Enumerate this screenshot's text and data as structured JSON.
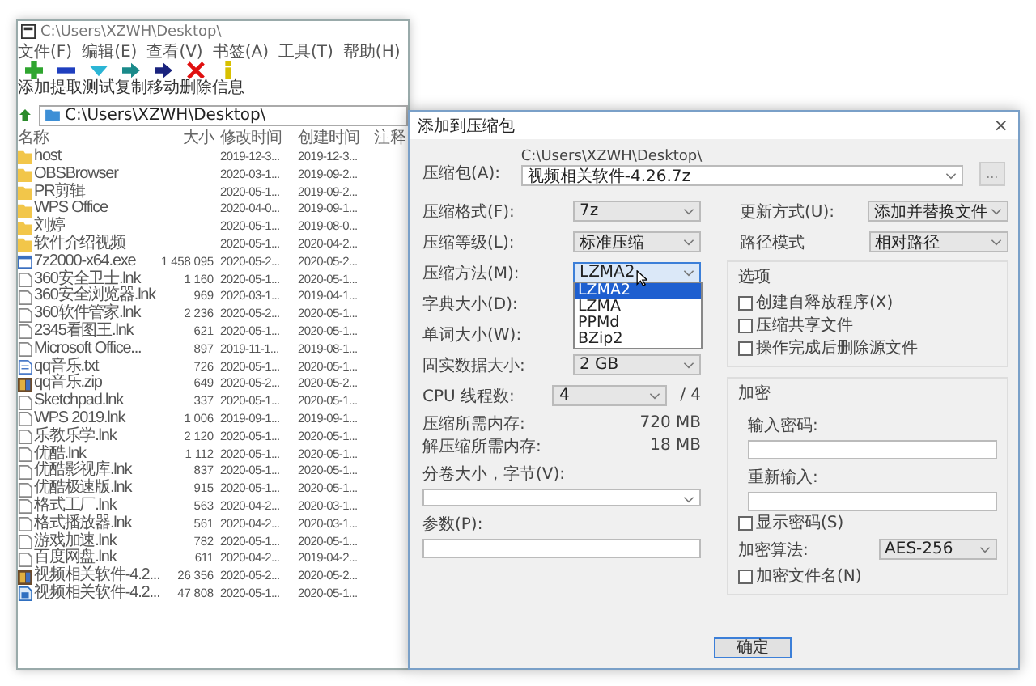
{
  "window": {
    "title": "C:\\Users\\XZWH\\Desktop\\"
  },
  "menu": [
    "文件(F)",
    "编辑(E)",
    "查看(V)",
    "书签(A)",
    "工具(T)",
    "帮助(H)"
  ],
  "toolbar": [
    {
      "label": "添加",
      "kind": "add"
    },
    {
      "label": "提取",
      "kind": "extract"
    },
    {
      "label": "测试",
      "kind": "test"
    },
    {
      "label": "复制",
      "kind": "copy"
    },
    {
      "label": "移动",
      "kind": "move"
    },
    {
      "label": "删除",
      "kind": "delete"
    },
    {
      "label": "信息",
      "kind": "info"
    }
  ],
  "address": "C:\\Users\\XZWH\\Desktop\\",
  "columns": [
    "名称",
    "大小",
    "修改时间",
    "创建时间",
    "注释"
  ],
  "files": [
    {
      "name": "host",
      "kind": "folder",
      "modified": "2019-12-3...",
      "created": "2019-12-3..."
    },
    {
      "name": "OBSBrowser",
      "kind": "folder",
      "modified": "2020-03-1...",
      "created": "2019-09-2..."
    },
    {
      "name": "PR剪辑",
      "kind": "folder",
      "modified": "2020-05-1...",
      "created": "2019-09-2..."
    },
    {
      "name": "WPS Office",
      "kind": "folder",
      "modified": "2020-04-0...",
      "created": "2019-09-1..."
    },
    {
      "name": "刘婷",
      "kind": "folder",
      "modified": "2020-05-1...",
      "created": "2019-08-0..."
    },
    {
      "name": "软件介绍视频",
      "kind": "folder",
      "modified": "2020-05-1...",
      "created": "2020-04-2..."
    },
    {
      "name": "7z2000-x64.exe",
      "kind": "exe",
      "size": "1 458 095",
      "modified": "2020-05-2...",
      "created": "2020-05-2..."
    },
    {
      "name": "360安全卫士.lnk",
      "kind": "file",
      "size": "1 160",
      "modified": "2020-05-1...",
      "created": "2020-05-1..."
    },
    {
      "name": "360安全浏览器.lnk",
      "kind": "file",
      "size": "969",
      "modified": "2020-03-1...",
      "created": "2019-04-1..."
    },
    {
      "name": "360软件管家.lnk",
      "kind": "file",
      "size": "2 236",
      "modified": "2020-05-2...",
      "created": "2020-05-1..."
    },
    {
      "name": "2345看图王.lnk",
      "kind": "file",
      "size": "621",
      "modified": "2020-05-1...",
      "created": "2020-05-1..."
    },
    {
      "name": "Microsoft Office...",
      "kind": "file",
      "size": "897",
      "modified": "2019-11-1...",
      "created": "2019-08-1..."
    },
    {
      "name": "qq音乐.txt",
      "kind": "txt",
      "size": "726",
      "modified": "2020-05-1...",
      "created": "2020-05-1..."
    },
    {
      "name": "qq音乐.zip",
      "kind": "archive",
      "size": "649",
      "modified": "2020-05-2...",
      "created": "2020-05-2..."
    },
    {
      "name": "Sketchpad.lnk",
      "kind": "file",
      "size": "337",
      "modified": "2020-05-1...",
      "created": "2020-05-1..."
    },
    {
      "name": "WPS 2019.lnk",
      "kind": "file",
      "size": "1 006",
      "modified": "2019-09-1...",
      "created": "2019-09-1..."
    },
    {
      "name": "乐教乐学.lnk",
      "kind": "file",
      "size": "2 120",
      "modified": "2020-05-1...",
      "created": "2020-05-1..."
    },
    {
      "name": "优酷.lnk",
      "kind": "file",
      "size": "1 112",
      "modified": "2020-05-1...",
      "created": "2020-05-1..."
    },
    {
      "name": "优酷影视库.lnk",
      "kind": "file",
      "size": "837",
      "modified": "2020-05-1...",
      "created": "2020-05-1..."
    },
    {
      "name": "优酷极速版.lnk",
      "kind": "file",
      "size": "915",
      "modified": "2020-05-1...",
      "created": "2020-05-1..."
    },
    {
      "name": "格式工厂.lnk",
      "kind": "file",
      "size": "563",
      "modified": "2020-04-2...",
      "created": "2020-03-1..."
    },
    {
      "name": "格式播放器.lnk",
      "kind": "file",
      "size": "561",
      "modified": "2020-04-2...",
      "created": "2020-03-1..."
    },
    {
      "name": "游戏加速.lnk",
      "kind": "file",
      "size": "782",
      "modified": "2020-05-1...",
      "created": "2020-05-1..."
    },
    {
      "name": "百度网盘.lnk",
      "kind": "file",
      "size": "611",
      "modified": "2020-04-2...",
      "created": "2019-04-2..."
    },
    {
      "name": "视频相关软件-4.2...",
      "kind": "archive",
      "size": "26 356",
      "modified": "2020-05-2...",
      "created": "2020-05-2..."
    },
    {
      "name": "视频相关软件-4.2...",
      "kind": "app",
      "size": "47 808",
      "modified": "2020-05-1...",
      "created": "2020-05-1..."
    }
  ],
  "dialog": {
    "title": "添加到压缩包",
    "close": "×",
    "archive_label": "压缩包(A):",
    "archive_path": "C:\\Users\\XZWH\\Desktop\\",
    "archive_name": "视频相关软件-4.26.7z",
    "browse": "...",
    "left_rows": [
      {
        "label": "压缩格式(F):",
        "value": "7z"
      },
      {
        "label": "压缩等级(L):",
        "value": "标准压缩"
      },
      {
        "label": "压缩方法(M):",
        "value": "LZMA2",
        "focused": true
      },
      {
        "label": "字典大小(D):"
      },
      {
        "label": "单词大小(W):"
      },
      {
        "label": "固实数据大小:",
        "value": "2 GB"
      },
      {
        "label": "CPU 线程数:",
        "value": "4",
        "suffix": "/ 4"
      }
    ],
    "method_options": [
      {
        "label": "LZMA2",
        "selected": true
      },
      {
        "label": "LZMA",
        "selected": false
      },
      {
        "label": "PPMd",
        "selected": false
      },
      {
        "label": "BZip2",
        "selected": false
      }
    ],
    "memory": [
      {
        "label": "压缩所需内存:",
        "value": "720 MB"
      },
      {
        "label": "解压缩所需内存:",
        "value": "18 MB"
      }
    ],
    "volume_label": "分卷大小，字节(V):",
    "params_label": "参数(P):",
    "right_rows": [
      {
        "label": "更新方式(U):",
        "value": "添加并替换文件"
      },
      {
        "label": "路径模式",
        "value": "相对路径"
      }
    ],
    "options_title": "选项",
    "options": [
      {
        "label": "创建自释放程序(X)",
        "checked": false
      },
      {
        "label": "压缩共享文件",
        "checked": false
      },
      {
        "label": "操作完成后删除源文件",
        "checked": false
      }
    ],
    "encryption_title": "加密",
    "password_label": "输入密码:",
    "reenter_label": "重新输入:",
    "show_password": {
      "label": "显示密码(S)",
      "checked": false
    },
    "algorithm_label": "加密算法:",
    "algorithm": "AES-256",
    "encrypt_names": {
      "label": "加密文件名(N)",
      "checked": false
    },
    "ok": "确定"
  }
}
